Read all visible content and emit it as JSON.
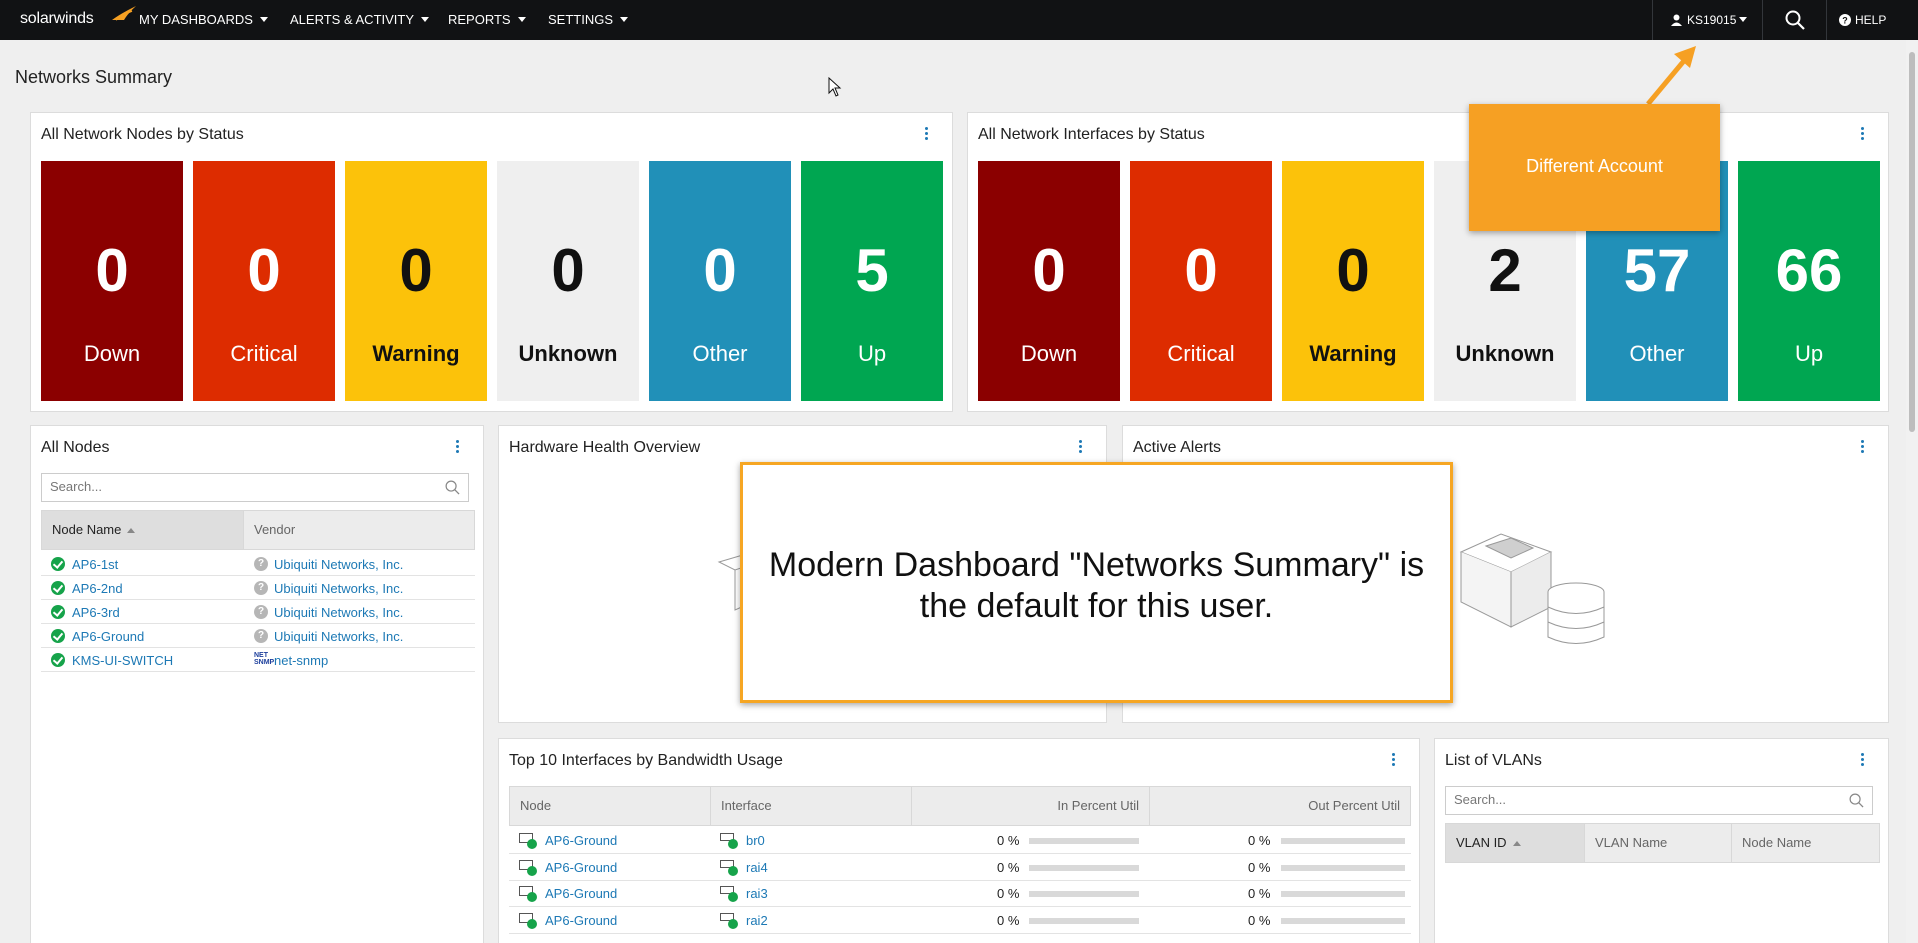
{
  "nav": {
    "logo": "solarwinds",
    "menu": [
      "MY DASHBOARDS",
      "ALERTS & ACTIVITY",
      "REPORTS",
      "SETTINGS"
    ],
    "user": "KS19015",
    "help": "HELP"
  },
  "page_title": "Networks Summary",
  "nodes_status": {
    "title": "All Network Nodes by Status",
    "tiles": [
      {
        "value": "0",
        "label": "Down",
        "color": "#8b0000"
      },
      {
        "value": "0",
        "label": "Critical",
        "color": "#dd2c00"
      },
      {
        "value": "0",
        "label": "Warning",
        "color": "#fcc20a"
      },
      {
        "value": "0",
        "label": "Unknown",
        "color": "#efefef"
      },
      {
        "value": "0",
        "label": "Other",
        "color": "#2190b8"
      },
      {
        "value": "5",
        "label": "Up",
        "color": "#00a651"
      }
    ]
  },
  "interfaces_status": {
    "title": "All Network Interfaces by Status",
    "tiles": [
      {
        "value": "0",
        "label": "Down",
        "color": "#8b0000"
      },
      {
        "value": "0",
        "label": "Critical",
        "color": "#dd2c00"
      },
      {
        "value": "0",
        "label": "Warning",
        "color": "#fcc20a"
      },
      {
        "value": "2",
        "label": "Unknown",
        "color": "#efefef"
      },
      {
        "value": "57",
        "label": "Other",
        "color": "#2190b8"
      },
      {
        "value": "66",
        "label": "Up",
        "color": "#00a651"
      }
    ]
  },
  "all_nodes": {
    "title": "All Nodes",
    "search_placeholder": "Search...",
    "columns": [
      "Node Name",
      "Vendor"
    ],
    "rows": [
      {
        "node": "AP6-1st",
        "vendor": "Ubiquiti Networks, Inc.",
        "vendor_icon": "unknown-vendor-icon"
      },
      {
        "node": "AP6-2nd",
        "vendor": "Ubiquiti Networks, Inc.",
        "vendor_icon": "unknown-vendor-icon"
      },
      {
        "node": "AP6-3rd",
        "vendor": "Ubiquiti Networks, Inc.",
        "vendor_icon": "unknown-vendor-icon"
      },
      {
        "node": "AP6-Ground",
        "vendor": "Ubiquiti Networks, Inc.",
        "vendor_icon": "unknown-vendor-icon"
      },
      {
        "node": "KMS-UI-SWITCH",
        "vendor": "net-snmp",
        "vendor_icon": "net-snmp-icon"
      }
    ]
  },
  "hardware_health": {
    "title": "Hardware Health Overview"
  },
  "active_alerts": {
    "title": "Active Alerts"
  },
  "top_interfaces": {
    "title": "Top 10 Interfaces by Bandwidth Usage",
    "columns": [
      "Node",
      "Interface",
      "In Percent Util",
      "Out Percent Util"
    ],
    "rows": [
      {
        "node": "AP6-Ground",
        "interface": "br0",
        "in": "0 %",
        "out": "0 %"
      },
      {
        "node": "AP6-Ground",
        "interface": "rai4",
        "in": "0 %",
        "out": "0 %"
      },
      {
        "node": "AP6-Ground",
        "interface": "rai3",
        "in": "0 %",
        "out": "0 %"
      },
      {
        "node": "AP6-Ground",
        "interface": "rai2",
        "in": "0 %",
        "out": "0 %"
      }
    ]
  },
  "vlans": {
    "title": "List of VLANs",
    "search_placeholder": "Search...",
    "columns": [
      "VLAN ID",
      "VLAN Name",
      "Node Name"
    ]
  },
  "callouts": {
    "main": "Modern Dashboard \"Networks Summary\" is the default for this user.",
    "account": "Different Account"
  },
  "colors": {
    "accent": "#f6a023",
    "link": "#1d79b5",
    "topbar": "#111214"
  }
}
